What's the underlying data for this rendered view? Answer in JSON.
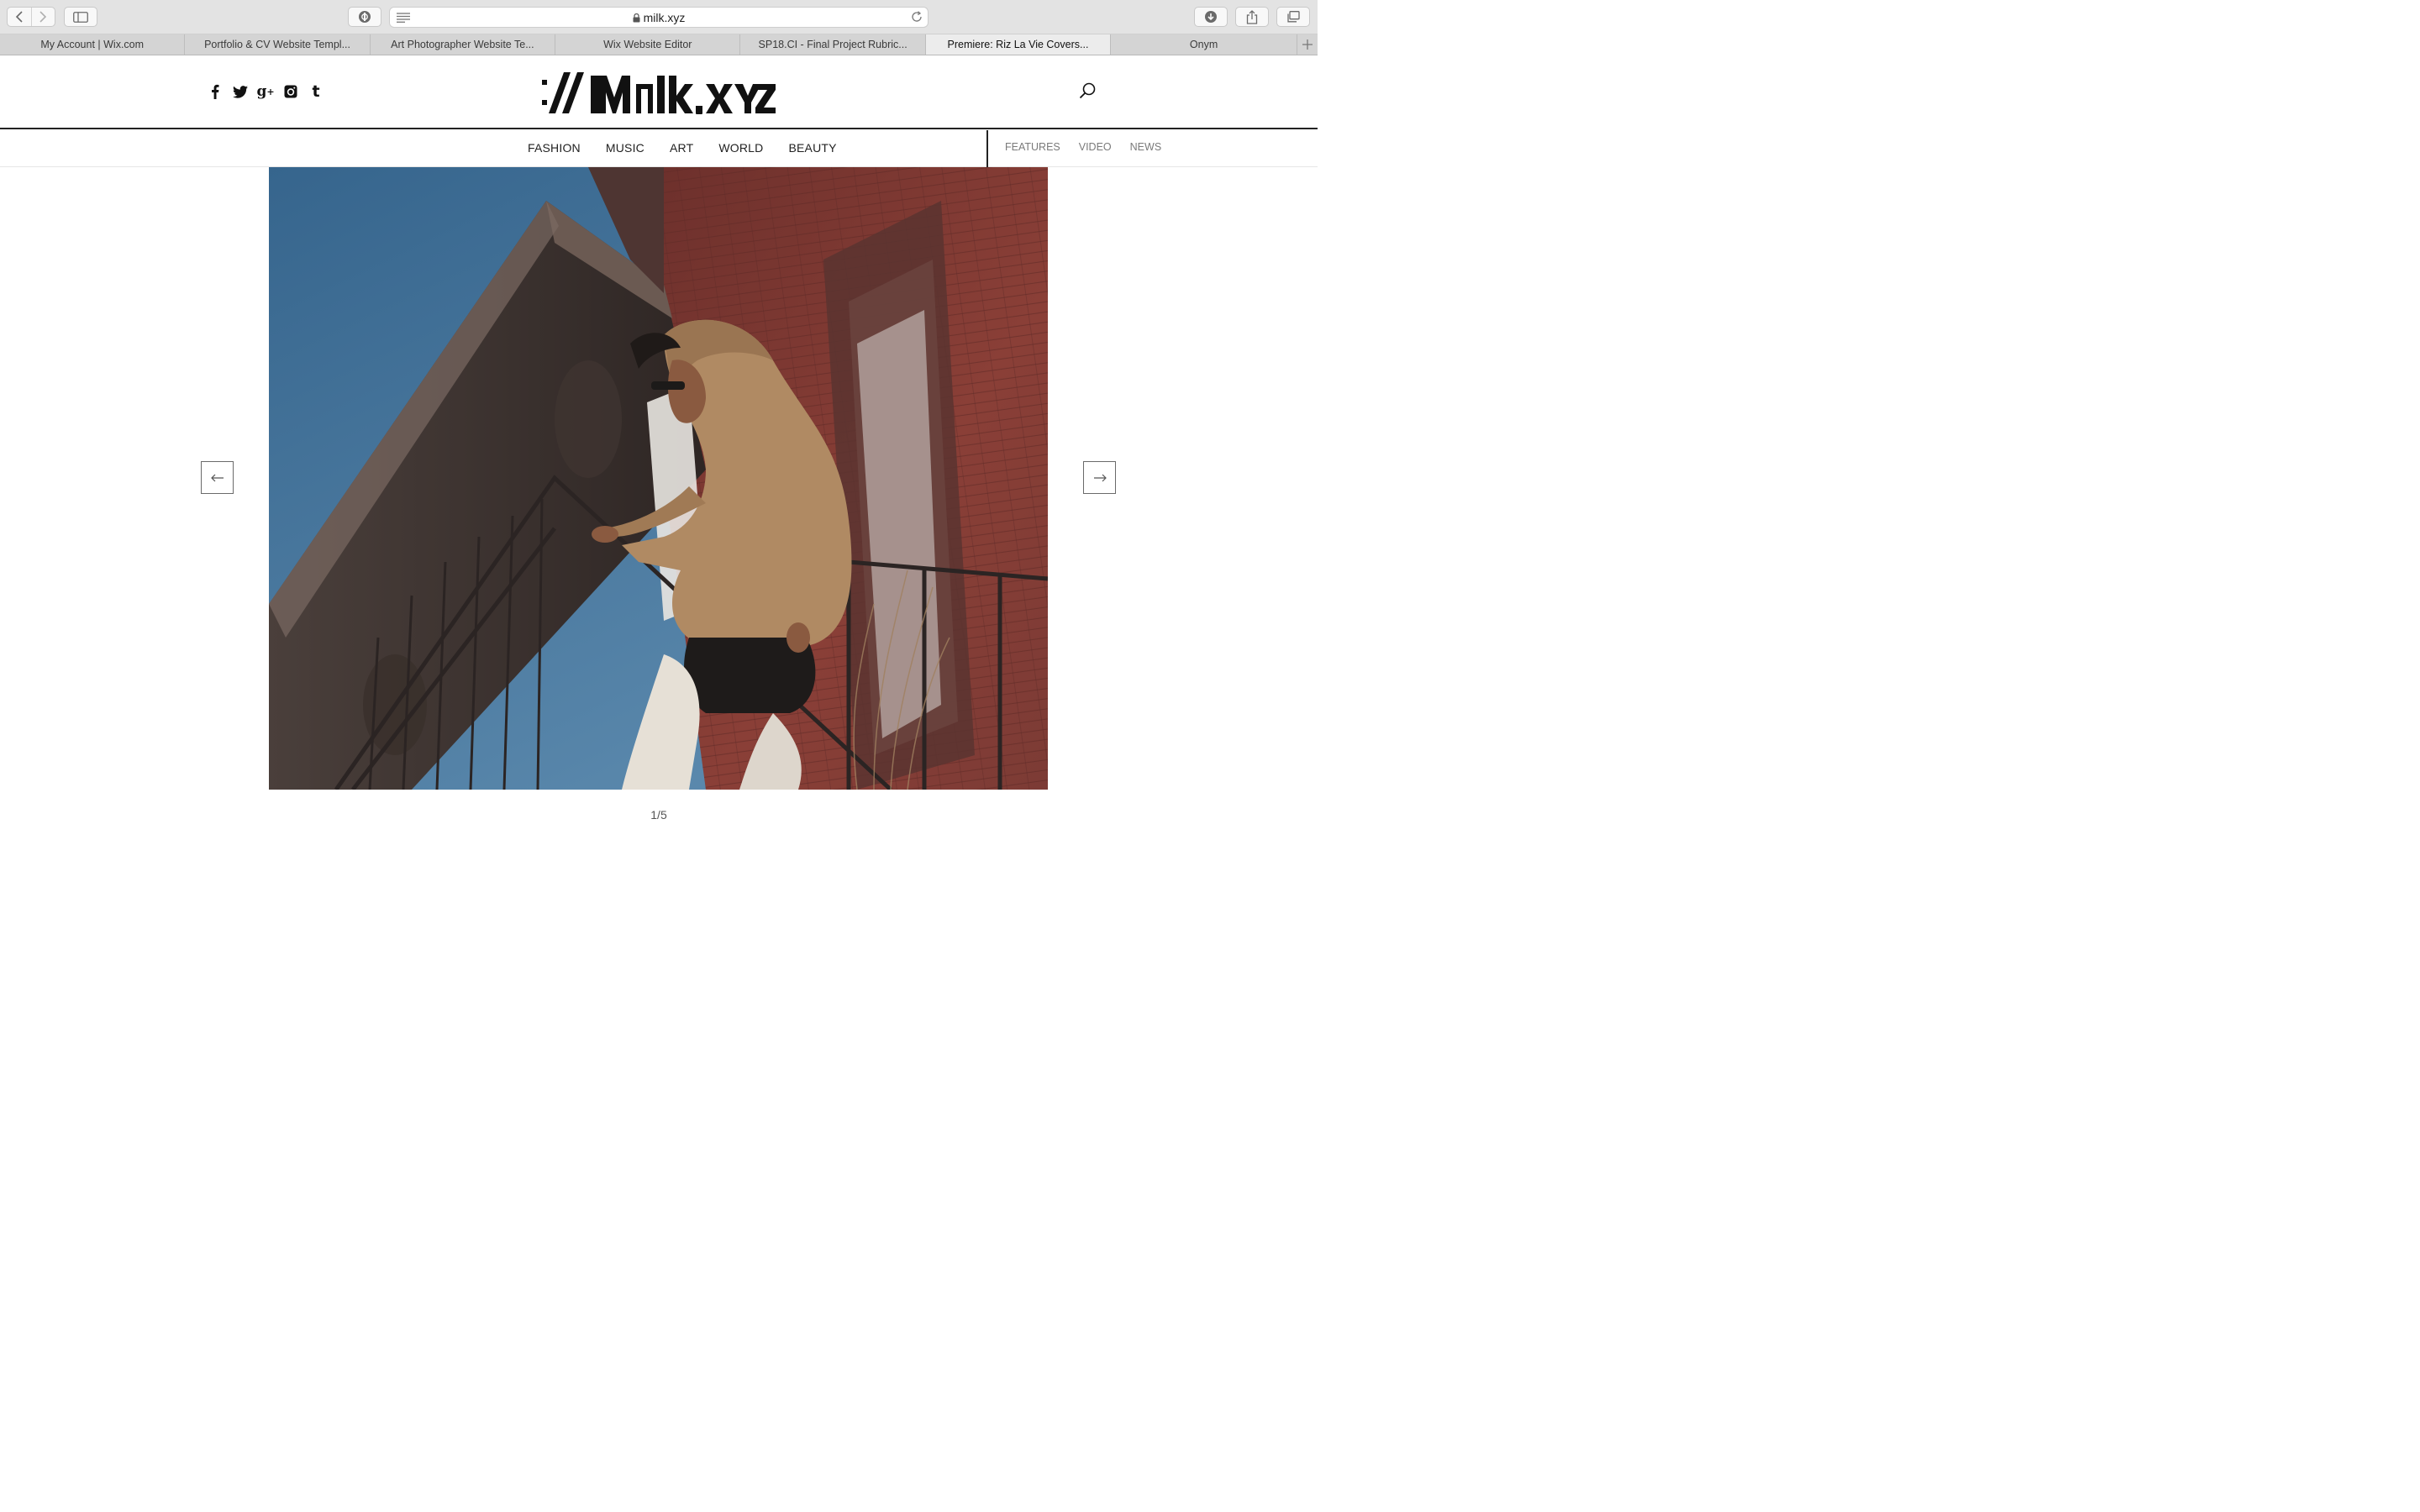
{
  "browser": {
    "url": "milk.xyz",
    "tabs": [
      {
        "label": "My Account | Wix.com",
        "active": false
      },
      {
        "label": "Portfolio & CV Website Templ...",
        "active": false
      },
      {
        "label": "Art Photographer Website Te...",
        "active": false
      },
      {
        "label": "Wix Website Editor",
        "active": false
      },
      {
        "label": "SP18.CI - Final Project Rubric...",
        "active": false
      },
      {
        "label": "Premiere: Riz La Vie Covers...",
        "active": true
      },
      {
        "label": "Onym",
        "active": false
      }
    ]
  },
  "site": {
    "logo_text": ":// Milk.XYZ",
    "social_icons": [
      "facebook-icon",
      "twitter-icon",
      "google-plus-icon",
      "instagram-icon",
      "tumblr-icon"
    ],
    "nav_primary": [
      "FASHION",
      "MUSIC",
      "ART",
      "WORLD",
      "BEAUTY"
    ],
    "nav_secondary": [
      "FEATURES",
      "VIDEO",
      "NEWS"
    ]
  },
  "gallery": {
    "counter": "1/5",
    "current_index": 1,
    "total": 5
  },
  "colors": {
    "sky": "#3f6f95",
    "brick": "#7a3a33",
    "hoodie": "#b08a63"
  }
}
